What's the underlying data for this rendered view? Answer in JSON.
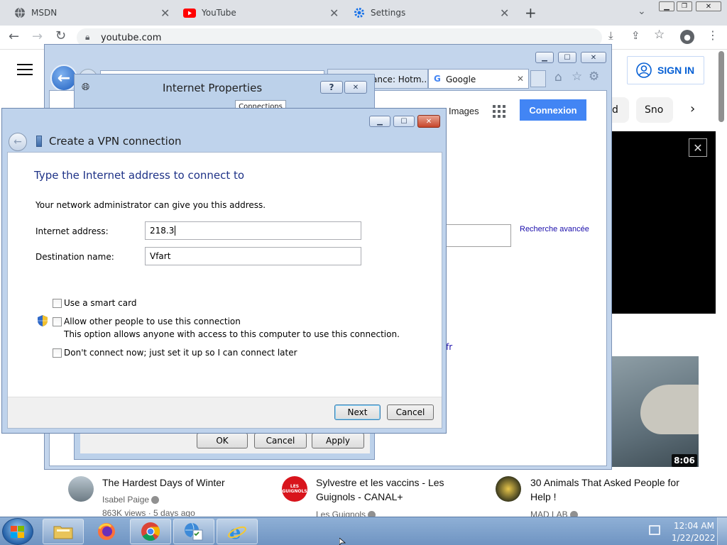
{
  "browser": {
    "tabs": [
      {
        "label": "MSDN",
        "icon": "globe-icon"
      },
      {
        "label": "YouTube",
        "icon": "youtube-icon"
      },
      {
        "label": "Settings",
        "icon": "gear-icon"
      }
    ],
    "new_tab": "+",
    "url": "youtube.com"
  },
  "youtube": {
    "sign_in": "SIGN IN",
    "chips": [
      "d",
      "Sno"
    ],
    "videos": [
      {
        "title": "The Hardest Days of Winter",
        "channel": "Isabel Paige",
        "meta": "863K views · 5 days ago"
      },
      {
        "title": "Sylvestre et les vaccins - Les Guignols - CANAL+",
        "channel": "Les Guignols",
        "meta": ""
      },
      {
        "title": "30 Animals That Asked People for Help !",
        "channel": "MAD LAB",
        "meta": ""
      }
    ],
    "duration": "8:06",
    "avatar_text": "LES GUIGNOLS"
  },
  "ie": {
    "tabs": [
      "ance: Hotm...",
      "Google"
    ],
    "google": {
      "images": "Images",
      "connexion": "Connexion",
      "advanced_search": "Recherche avancée",
      "fr_link": "fr"
    }
  },
  "internet_properties": {
    "title": "Internet Properties",
    "help": "?",
    "active_tab": "Connections",
    "ok": "OK",
    "cancel": "Cancel",
    "apply": "Apply"
  },
  "vpn": {
    "title": "Create a VPN connection",
    "heading": "Type the Internet address to connect to",
    "intro": "Your network administrator can give you this address.",
    "internet_address_label": "Internet address:",
    "internet_address_value": "218.3",
    "destination_label": "Destination name:",
    "destination_value": "Vfart",
    "smart_card": "Use a smart card",
    "allow_others": "Allow other people to use this connection",
    "allow_others_desc": "This option allows anyone with access to this computer to use this connection.",
    "dont_connect": "Don't connect now; just set it up so I can connect later",
    "next": "Next",
    "cancel": "Cancel"
  },
  "taskbar": {
    "time": "12:04 AM",
    "date": "1/22/2022"
  }
}
